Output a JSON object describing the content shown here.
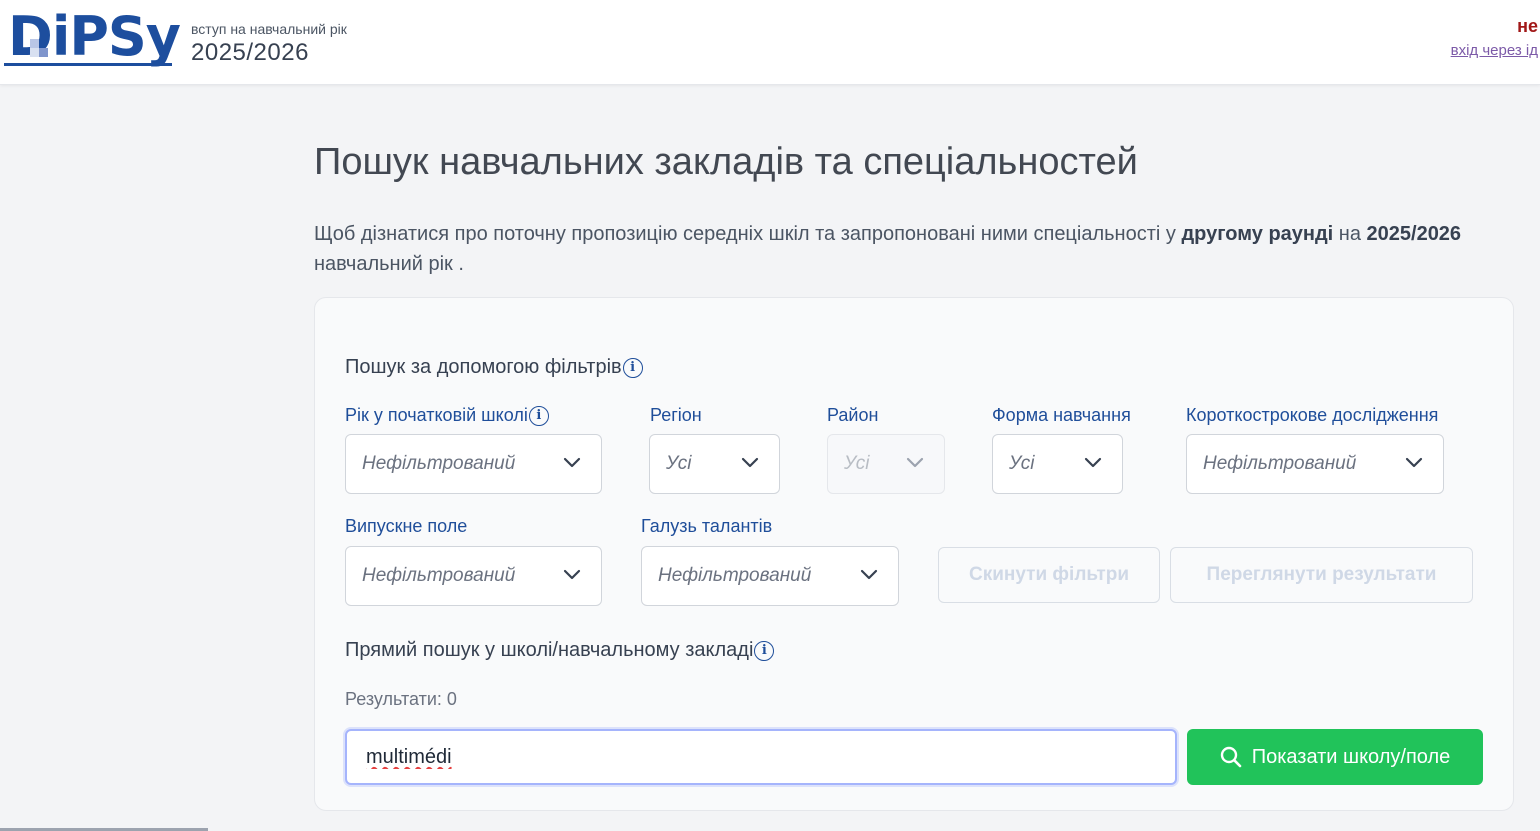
{
  "header": {
    "logo_text": "DiPSy",
    "subtitle": "вступ на навчальний рік",
    "year": "2025/2026",
    "right_top": "не",
    "right_link": "вхід через ід"
  },
  "page": {
    "title": "Пошук навчальних закладів та спеціальностей",
    "intro_part1": "Щоб дізнатися про поточну пропозицію середніх шкіл та запропоновані ними спеціальності у ",
    "intro_bold1": "другому раунді",
    "intro_part2": " на ",
    "intro_bold2": "2025/2026",
    "intro_part3": " навчальний рік ."
  },
  "filters": {
    "section_title": "Пошук за допомогою фільтрів",
    "year_label": "Рік у початковій школі",
    "year_value": "Нефільтрований",
    "region_label": "Регіон",
    "region_value": "Усі",
    "district_label": "Район",
    "district_value": "Усі",
    "form_label": "Форма навчання",
    "form_value": "Усі",
    "short_label": "Короткострокове дослідження",
    "short_value": "Нефільтрований",
    "grad_label": "Випускне поле",
    "grad_value": "Нефільтрований",
    "talent_label": "Галузь талантів",
    "talent_value": "Нефільтрований",
    "reset_label": "Скинути фільтри",
    "view_label": "Переглянути результати"
  },
  "direct": {
    "section_title": "Прямий пошук у школі/навчальному закладі",
    "results_label": "Результати: 0",
    "input_value": "multimédi",
    "button_label": "Показати школу/поле"
  },
  "colors": {
    "brand": "#1d4e9e",
    "accent_green": "#21c35a",
    "label_blue": "#1f4e9a"
  }
}
